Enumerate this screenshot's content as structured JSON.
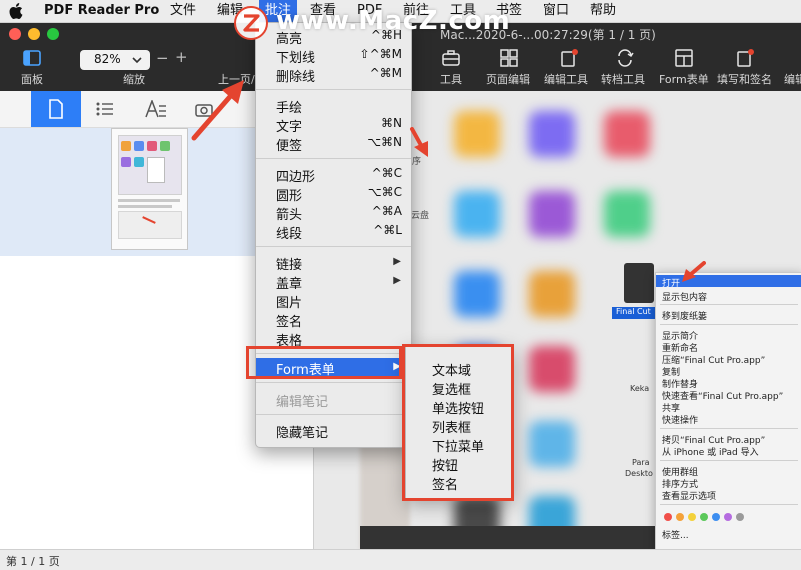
{
  "menubar": {
    "app_name": "PDF Reader Pro",
    "items": [
      "文件",
      "编辑",
      "批注",
      "查看",
      "PDF",
      "前往",
      "工具",
      "书签",
      "窗口",
      "帮助"
    ],
    "active_index": 2
  },
  "toolbar": {
    "panel_label": "面板",
    "zoom_label": "缩放",
    "zoom_value": "82%",
    "zoom_minus": "−",
    "zoom_plus": "+",
    "page_label": "上一页/下",
    "title": "Mac...2020-6-...00:27:29(第 1 / 1 页)",
    "tools_label": "工具",
    "page_edit_label": "页面编辑",
    "edit_tool_label": "编辑工具",
    "convert_label": "转档工具",
    "form_label": "Form表单",
    "fill_sign_label": "填写和签名",
    "edit_label_partial": "编辑"
  },
  "menu": {
    "items": [
      {
        "label": "高亮",
        "shortcut": "^⌘H"
      },
      {
        "label": "下划线",
        "shortcut": "⇧^⌘M"
      },
      {
        "label": "删除线",
        "shortcut": "^⌘M"
      },
      {
        "label": "手绘",
        "shortcut": ""
      },
      {
        "label": "文字",
        "shortcut": "⌘N"
      },
      {
        "label": "便签",
        "shortcut": "⌥⌘N"
      },
      {
        "label": "四边形",
        "shortcut": "^⌘C"
      },
      {
        "label": "圆形",
        "shortcut": "⌥⌘C"
      },
      {
        "label": "箭头",
        "shortcut": "^⌘A"
      },
      {
        "label": "线段",
        "shortcut": "^⌘L"
      },
      {
        "label": "链接",
        "shortcut": ""
      },
      {
        "label": "盖章",
        "shortcut": ""
      },
      {
        "label": "图片",
        "shortcut": ""
      },
      {
        "label": "签名",
        "shortcut": ""
      },
      {
        "label": "表格",
        "shortcut": ""
      },
      {
        "label": "Form表单",
        "shortcut": ""
      },
      {
        "label": "编辑笔记",
        "shortcut": ""
      },
      {
        "label": "隐藏笔记",
        "shortcut": ""
      }
    ],
    "submenu_arrow": "▶"
  },
  "submenu": {
    "items": [
      "文本域",
      "复选框",
      "单选按钮",
      "列表框",
      "下拉菜单",
      "按钮",
      "签名"
    ]
  },
  "context_menu": {
    "items": [
      "打开",
      "显示包内容",
      "移到废纸篓",
      "显示简介",
      "重新命名",
      "压缩“Final Cut Pro.app”",
      "复制",
      "制作替身",
      "快速查看“Final Cut Pro.app”",
      "共享",
      "快速操作",
      "拷贝“Final Cut Pro.app”",
      "从 iPhone 或 iPad 导入",
      "使用群组",
      "排序方式",
      "查看显示选项",
      "标签..."
    ],
    "selected_file": "Final Cut",
    "side_labels": [
      "序",
      "云盘",
      "Keka",
      "Para",
      "Deskto"
    ]
  },
  "statusbar": {
    "page_text": "第 1 / 1 页"
  },
  "watermark": {
    "text": "www.MacZ.com"
  },
  "colors": {
    "accent": "#2f6ee6",
    "highlight_red": "#e4442f",
    "toolbar_bg": "#2b2b2b",
    "tab_active": "#2d7ef7"
  }
}
